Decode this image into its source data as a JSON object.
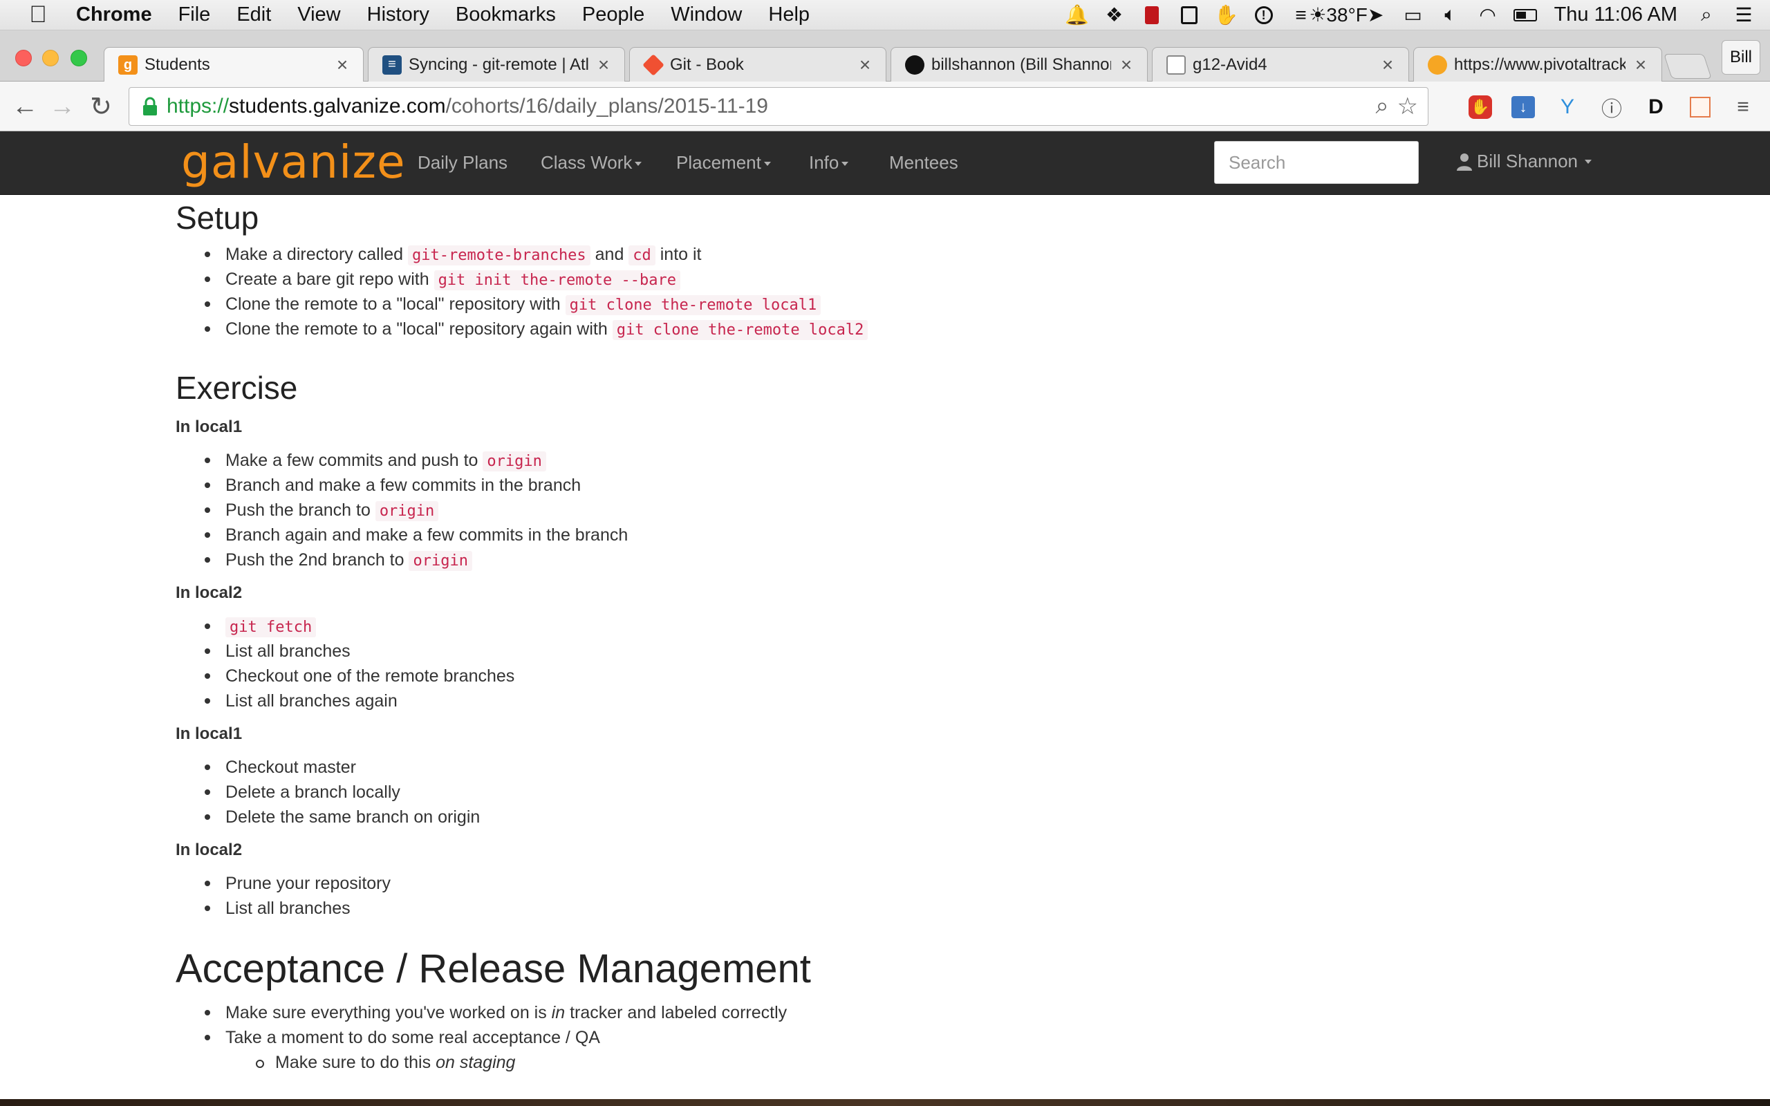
{
  "menubar": {
    "app_name": "Chrome",
    "items": [
      "File",
      "Edit",
      "View",
      "History",
      "Bookmarks",
      "People",
      "Window",
      "Help"
    ],
    "weather": "38°F",
    "clock": "Thu 11:06 AM"
  },
  "tabs": [
    {
      "title": "Students",
      "icon": "galvanize-favicon-icon"
    },
    {
      "title": "Syncing - git-remote | Atla",
      "icon": "atlassian-favicon-icon"
    },
    {
      "title": "Git - Book",
      "icon": "git-favicon-icon"
    },
    {
      "title": "billshannon (Bill Shannon)",
      "icon": "github-favicon-icon"
    },
    {
      "title": "g12-Avid4",
      "icon": "generic-page-icon"
    },
    {
      "title": "https://www.pivotaltracker",
      "icon": "pivotal-favicon-icon"
    }
  ],
  "profile_name": "Bill",
  "address": {
    "scheme": "https://",
    "host": "students.galvanize.com",
    "path": "/cohorts/16/daily_plans/2015-11-19"
  },
  "site_nav": {
    "logo": "galvanize",
    "links": [
      "Daily Plans",
      "Class Work",
      "Placement",
      "Info",
      "Mentees"
    ],
    "search_placeholder": "Search",
    "user": "Bill Shannon"
  },
  "content": {
    "setup_heading": "Setup",
    "setup": [
      {
        "t1": "Make a directory called ",
        "c1": "git-remote-branches",
        "t2": " and ",
        "c2": "cd",
        "t3": " into it"
      },
      {
        "t1": "Create a bare git repo with ",
        "c1": "git init the-remote --bare"
      },
      {
        "t1": "Clone the remote to a \"local\" repository with ",
        "c1": "git clone the-remote local1"
      },
      {
        "t1": "Clone the remote to a \"local\" repository again with ",
        "c1": "git clone the-remote local2"
      }
    ],
    "exercise_heading": "Exercise",
    "sub1": "In local1",
    "list1": [
      {
        "t1": "Make a few commits and push to ",
        "c1": "origin"
      },
      {
        "t1": "Branch and make a few commits in the branch"
      },
      {
        "t1": "Push the branch to ",
        "c1": "origin"
      },
      {
        "t1": "Branch again and make a few commits in the branch"
      },
      {
        "t1": "Push the 2nd branch to ",
        "c1": "origin"
      }
    ],
    "sub2": "In local2",
    "list2": [
      {
        "c1": "git fetch"
      },
      {
        "t1": "List all branches"
      },
      {
        "t1": "Checkout one of the remote branches"
      },
      {
        "t1": "List all branches again"
      }
    ],
    "sub3": "In local1",
    "list3": [
      "Checkout master",
      "Delete a branch locally",
      "Delete the same branch on origin"
    ],
    "sub4": "In local2",
    "list4": [
      "Prune your repository",
      "List all branches"
    ],
    "release_heading": "Acceptance / Release Management",
    "release": [
      {
        "t1": "Make sure everything you've worked on is ",
        "em": "in",
        "t2": " tracker and labeled correctly"
      },
      {
        "t1": "Take a moment to do some real acceptance / QA"
      }
    ],
    "release_nested": {
      "t1": "Make sure to do this ",
      "em": "on staging"
    }
  }
}
